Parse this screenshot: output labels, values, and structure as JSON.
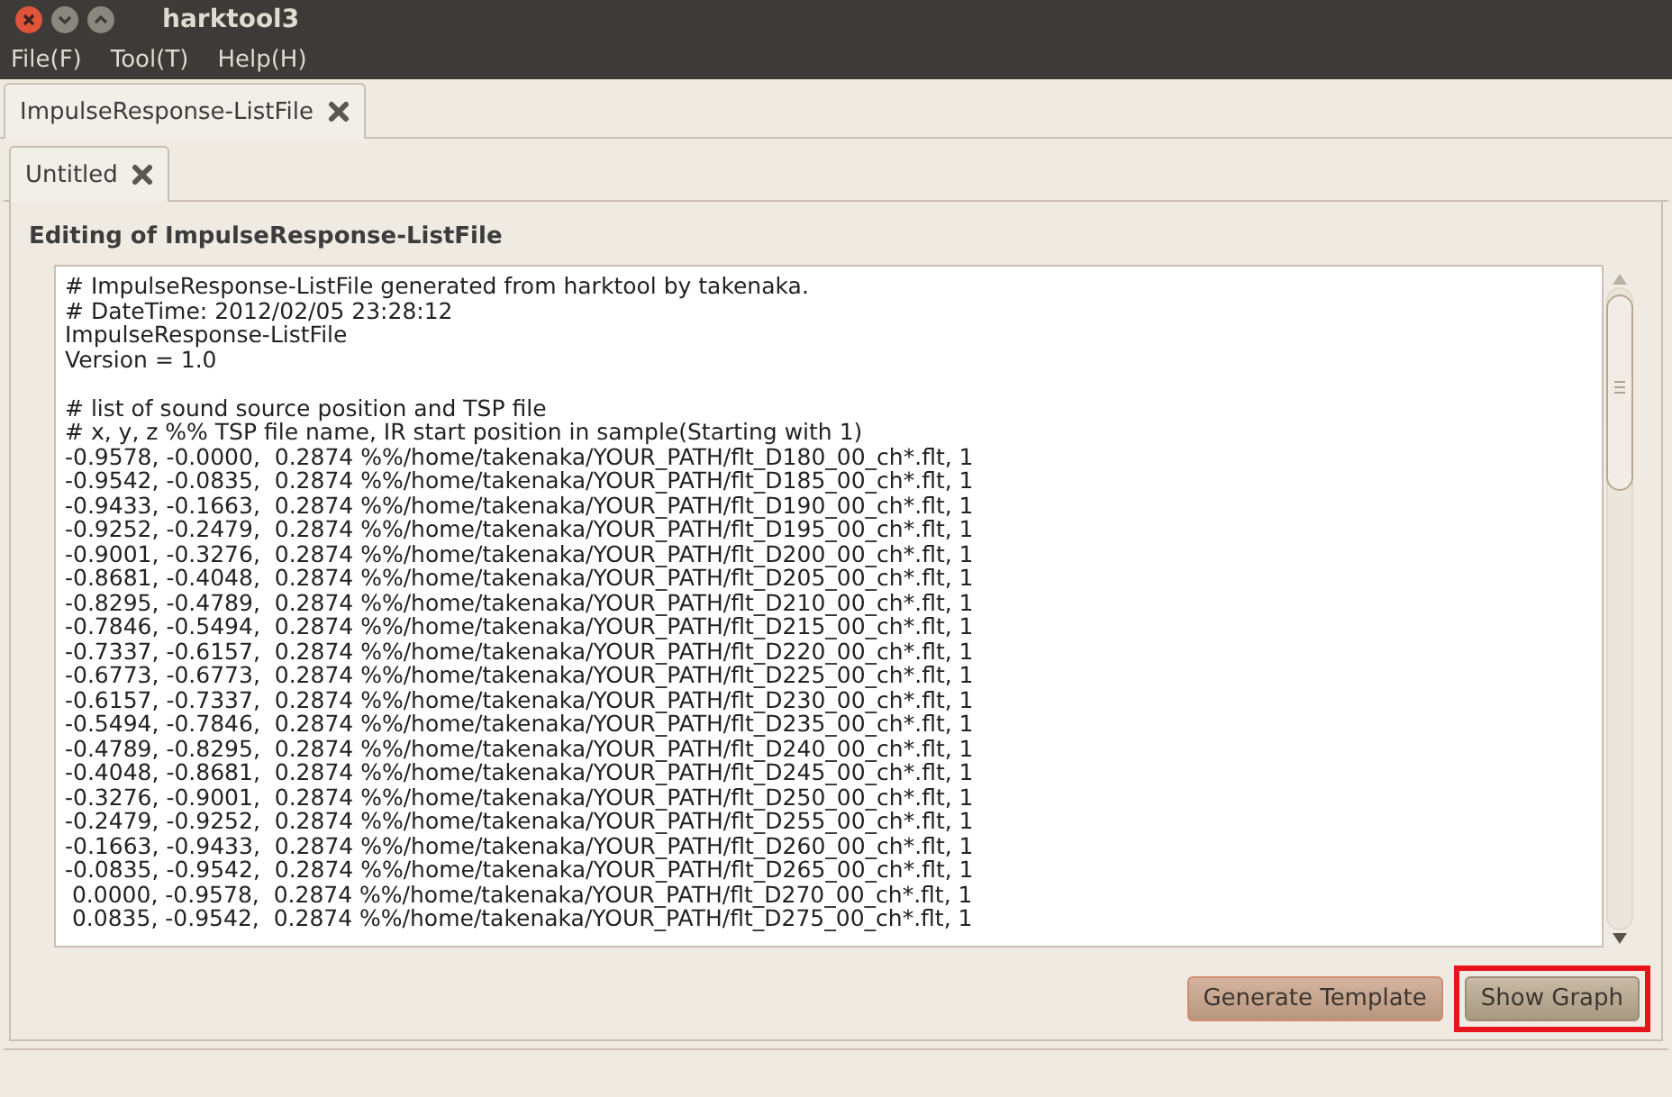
{
  "window": {
    "title": "harktool3"
  },
  "menu": [
    {
      "label": "File(F)"
    },
    {
      "label": "Tool(T)"
    },
    {
      "label": "Help(H)"
    }
  ],
  "document_tabs": [
    {
      "label": "ImpulseResponse-ListFile",
      "selected": true
    }
  ],
  "sub_tabs": [
    {
      "label": "Untitled",
      "selected": true
    }
  ],
  "panel": {
    "title": "Editing of ImpulseResponse-ListFile"
  },
  "editor": {
    "blocks": [
      [
        "# ImpulseResponse-ListFile generated from harktool by takenaka.",
        "# DateTime: 2012/02/05 23:28:12",
        "ImpulseResponse-ListFile",
        "Version = 1.0"
      ],
      [
        "# list of sound source position and TSP file",
        "# x, y, z %% TSP file name, IR start position in sample(Starting with 1)",
        "-0.9578, -0.0000,  0.2874 %%/home/takenaka/YOUR_PATH/flt_D180_00_ch*.flt, 1",
        "-0.9542, -0.0835,  0.2874 %%/home/takenaka/YOUR_PATH/flt_D185_00_ch*.flt, 1",
        "-0.9433, -0.1663,  0.2874 %%/home/takenaka/YOUR_PATH/flt_D190_00_ch*.flt, 1",
        "-0.9252, -0.2479,  0.2874 %%/home/takenaka/YOUR_PATH/flt_D195_00_ch*.flt, 1",
        "-0.9001, -0.3276,  0.2874 %%/home/takenaka/YOUR_PATH/flt_D200_00_ch*.flt, 1",
        "-0.8681, -0.4048,  0.2874 %%/home/takenaka/YOUR_PATH/flt_D205_00_ch*.flt, 1",
        "-0.8295, -0.4789,  0.2874 %%/home/takenaka/YOUR_PATH/flt_D210_00_ch*.flt, 1",
        "-0.7846, -0.5494,  0.2874 %%/home/takenaka/YOUR_PATH/flt_D215_00_ch*.flt, 1",
        "-0.7337, -0.6157,  0.2874 %%/home/takenaka/YOUR_PATH/flt_D220_00_ch*.flt, 1",
        "-0.6773, -0.6773,  0.2874 %%/home/takenaka/YOUR_PATH/flt_D225_00_ch*.flt, 1",
        "-0.6157, -0.7337,  0.2874 %%/home/takenaka/YOUR_PATH/flt_D230_00_ch*.flt, 1",
        "-0.5494, -0.7846,  0.2874 %%/home/takenaka/YOUR_PATH/flt_D235_00_ch*.flt, 1",
        "-0.4789, -0.8295,  0.2874 %%/home/takenaka/YOUR_PATH/flt_D240_00_ch*.flt, 1",
        "-0.4048, -0.8681,  0.2874 %%/home/takenaka/YOUR_PATH/flt_D245_00_ch*.flt, 1",
        "-0.3276, -0.9001,  0.2874 %%/home/takenaka/YOUR_PATH/flt_D250_00_ch*.flt, 1",
        "-0.2479, -0.9252,  0.2874 %%/home/takenaka/YOUR_PATH/flt_D255_00_ch*.flt, 1",
        "-0.1663, -0.9433,  0.2874 %%/home/takenaka/YOUR_PATH/flt_D260_00_ch*.flt, 1",
        "-0.0835, -0.9542,  0.2874 %%/home/takenaka/YOUR_PATH/flt_D265_00_ch*.flt, 1",
        " 0.0000, -0.9578,  0.2874 %%/home/takenaka/YOUR_PATH/flt_D270_00_ch*.flt, 1",
        " 0.0835, -0.9542,  0.2874 %%/home/takenaka/YOUR_PATH/flt_D275_00_ch*.flt, 1"
      ]
    ]
  },
  "buttons": [
    {
      "label": "Generate Template",
      "kind": "accent",
      "highlighted": false
    },
    {
      "label": "Show Graph",
      "kind": "normal",
      "highlighted": true
    }
  ]
}
